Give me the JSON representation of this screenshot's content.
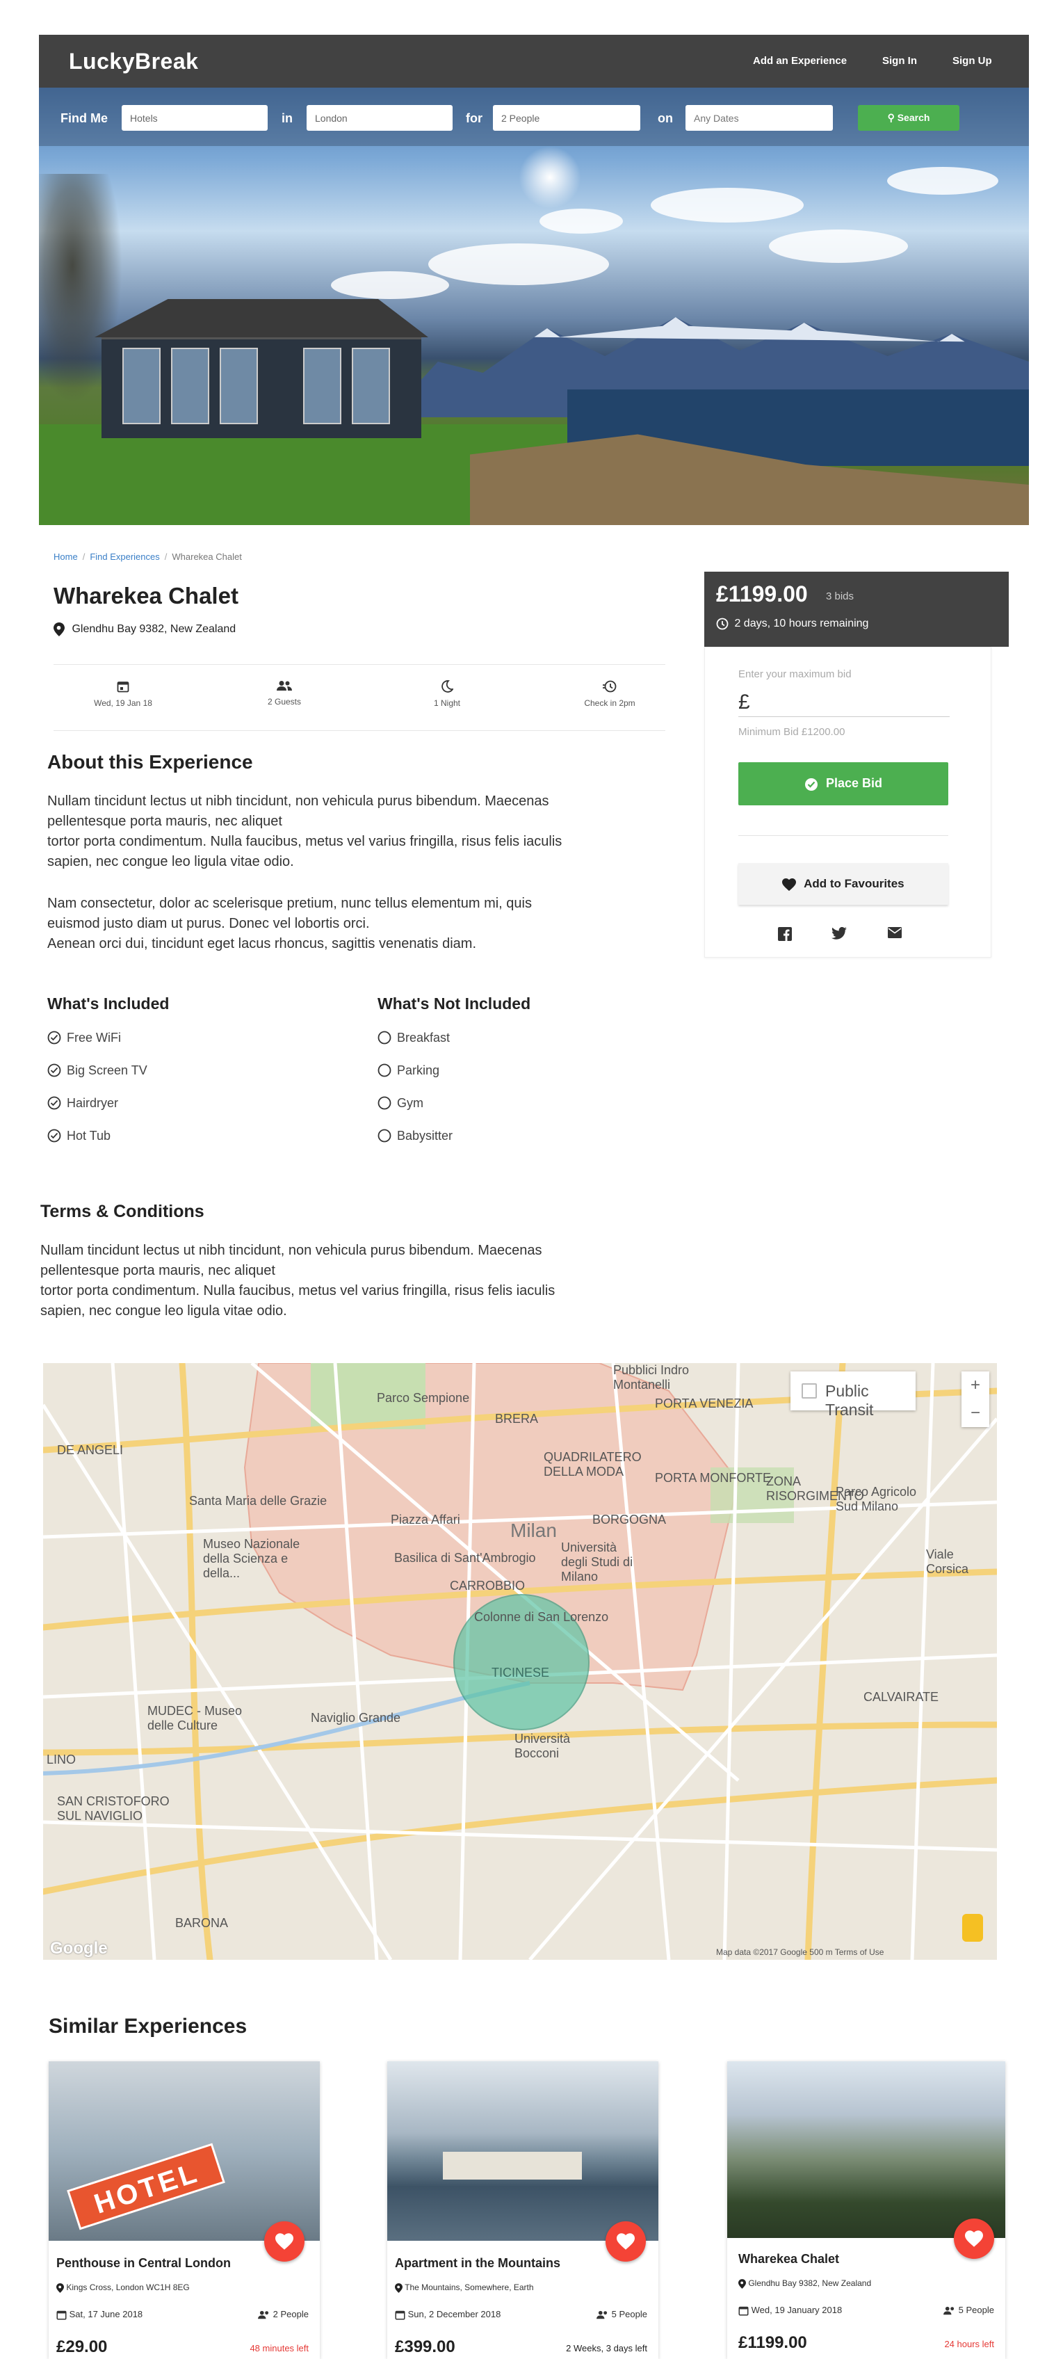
{
  "header": {
    "brand": "LuckyBreak",
    "nav": [
      "Add an Experience",
      "Sign In",
      "Sign Up"
    ]
  },
  "search": {
    "find_label": "Find Me",
    "type_value": "Hotels",
    "in_label": "in",
    "location_value": "London",
    "for_label": "for",
    "guests_value": "2 People",
    "on_label": "on",
    "dates_placeholder": "Any Dates",
    "button_label": "Search"
  },
  "breadcrumb": [
    "Home",
    "Find Experiences",
    "Wharekea Chalet"
  ],
  "listing": {
    "title": "Wharekea Chalet",
    "address": "Glendhu Bay 9382, New Zealand",
    "facts": [
      {
        "icon": "calendar-icon",
        "label": "Wed, 19 Jan 18"
      },
      {
        "icon": "people-icon",
        "label": "2 Guests"
      },
      {
        "icon": "moon-icon",
        "label": "1 Night"
      },
      {
        "icon": "clock-icon",
        "label": "Check in 2pm"
      }
    ]
  },
  "about": {
    "heading": "About this Experience",
    "p1": [
      "Nullam tincidunt lectus ut nibh tincidunt, non vehicula purus bibendum. Maecenas",
      "pellentesque porta mauris, nec aliquet",
      "tortor porta condimentum. Nulla faucibus, metus vel varius fringilla, risus felis iaculis",
      "sapien, nec congue leo ligula vitae odio."
    ],
    "p2": [
      "Nam consectetur, dolor ac scelerisque pretium, nunc tellus elementum mi, quis",
      "euismod justo diam ut purus. Donec vel lobortis orci.",
      "Aenean orci dui, tincidunt eget lacus rhoncus, sagittis venenatis diam."
    ]
  },
  "included": {
    "heading": "What's Included",
    "items": [
      "Free WiFi",
      "Big Screen TV",
      "Hairdryer",
      "Hot Tub"
    ]
  },
  "not_included": {
    "heading": "What's Not Included",
    "items": [
      "Breakfast",
      "Parking",
      "Gym",
      "Babysitter"
    ]
  },
  "terms": {
    "heading": "Terms & Conditions",
    "text": [
      "Nullam tincidunt lectus ut nibh tincidunt, non vehicula purus bibendum. Maecenas",
      "pellentesque porta mauris, nec aliquet",
      "tortor porta condimentum. Nulla faucibus, metus vel varius fringilla, risus felis iaculis",
      "sapien, nec congue leo ligula vitae odio."
    ]
  },
  "bid": {
    "price": "£1199.00",
    "bids": "3 bids",
    "remaining": "2 days, 10 hours remaining",
    "input_label": "Enter your maximum bid",
    "currency": "£",
    "minimum": "Minimum Bid £1200.00",
    "place_bid": "Place Bid",
    "favourite": "Add to Favourites"
  },
  "map": {
    "public_transit": "Public Transit",
    "zoom_in": "+",
    "zoom_out": "−",
    "footer": "Map data ©2017 Google   500 m           Terms of Use",
    "google": "Google",
    "labels": [
      "Milan",
      "Parco Sempione",
      "BRERA",
      "PORTA VENEZIA",
      "QUADRILATERO DELLA MODA",
      "PORTA MONFORTE",
      "ZONA RISORGIMENTO",
      "Parco Agricolo Sud Milano",
      "Santa Maria delle Grazie",
      "Piazza Affari",
      "BORGOGNA",
      "Museo Nazionale della Scienza e della...",
      "Basilica di Sant'Ambrogio",
      "Università degli Studi di Milano",
      "CARROBBIO",
      "Colonne di San Lorenzo",
      "TICINESE",
      "MUDEC - Museo delle Culture",
      "Naviglio Grande",
      "Università Bocconi",
      "CALVAIRATE",
      "DE ANGELI",
      "SAN CRISTOFORO SUL NAVIGLIO",
      "BARONA",
      "Pubblici Indro Montanelli",
      "Viale Corsica",
      "LINO"
    ]
  },
  "similar": {
    "heading": "Similar Experiences",
    "cards": [
      {
        "title": "Penthouse in Central London",
        "location": "Kings Cross, London WC1H 8EG",
        "date": "Sat, 17 June 2018",
        "guests": "2 People",
        "price": "£29.00",
        "time": "48 minutes left",
        "urgent": true
      },
      {
        "title": "Apartment in the Mountains",
        "location": "The Mountains, Somewhere, Earth",
        "date": "Sun, 2 December 2018",
        "guests": "5 People",
        "price": "£399.00",
        "time": "2 Weeks, 3 days left",
        "urgent": false
      },
      {
        "title": "Wharekea Chalet",
        "location": "Glendhu Bay 9382, New Zealand",
        "date": "Wed, 19 January 2018",
        "guests": "5 People",
        "price": "£1199.00",
        "time": "24 hours left",
        "urgent": true
      }
    ],
    "hotel_sign": "HOTEL"
  },
  "colors": {
    "dark": "#424242",
    "green": "#4caf50",
    "red": "#f44336",
    "link": "#3a7fc7"
  }
}
